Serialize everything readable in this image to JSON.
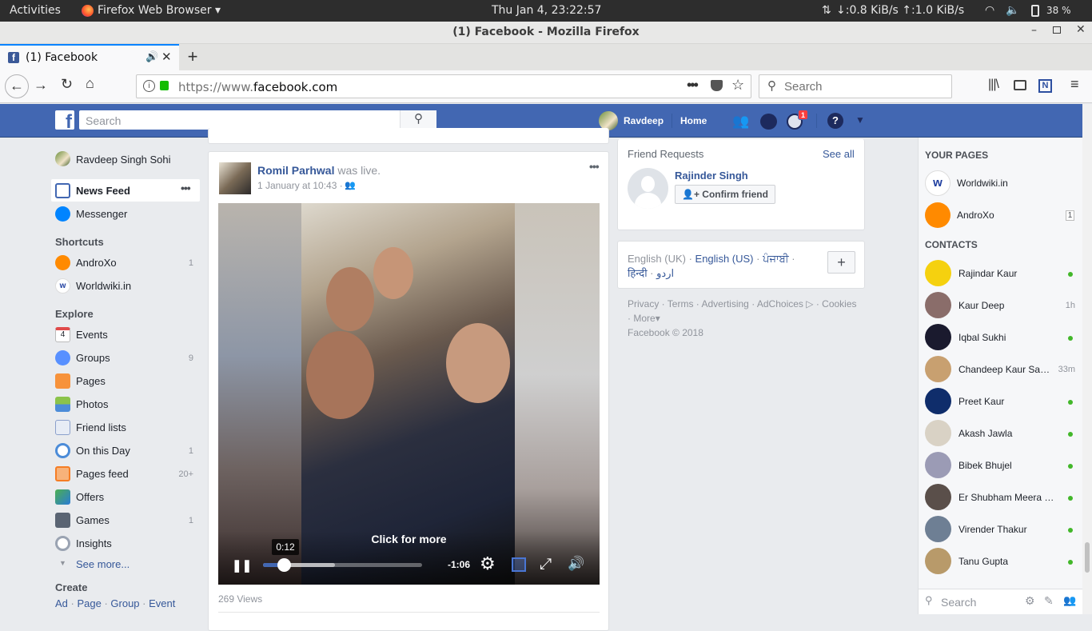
{
  "system": {
    "activities": "Activities",
    "app_name": "Firefox Web Browser",
    "clock": "Thu Jan  4, 23:22:57",
    "network": "↓:0.8 KiB/s ↑:1.0 KiB/s",
    "battery": "38 %"
  },
  "window": {
    "title": "(1) Facebook - Mozilla Firefox"
  },
  "browser": {
    "tab_title": "(1) Facebook",
    "url_prefix": "https://www.",
    "url_domain": "facebook.com",
    "search_placeholder": "Search"
  },
  "fb_header": {
    "search_placeholder": "Search",
    "user_name": "Ravdeep",
    "home_label": "Home",
    "notif_count": "1"
  },
  "left_nav": {
    "profile_name": "Ravdeep Singh Sohi",
    "news_feed": "News Feed",
    "messenger": "Messenger",
    "shortcuts_title": "Shortcuts",
    "shortcuts": [
      {
        "label": "AndroXo",
        "count": "1"
      },
      {
        "label": "Worldwiki.in",
        "count": ""
      }
    ],
    "explore_title": "Explore",
    "explore": [
      {
        "label": "Events",
        "count": ""
      },
      {
        "label": "Groups",
        "count": "9"
      },
      {
        "label": "Pages",
        "count": ""
      },
      {
        "label": "Photos",
        "count": ""
      },
      {
        "label": "Friend lists",
        "count": ""
      },
      {
        "label": "On this Day",
        "count": "1"
      },
      {
        "label": "Pages feed",
        "count": "20+"
      },
      {
        "label": "Offers",
        "count": ""
      },
      {
        "label": "Games",
        "count": "1"
      },
      {
        "label": "Insights",
        "count": ""
      }
    ],
    "see_more": "See more...",
    "create_title": "Create",
    "create_links": [
      "Ad",
      "Page",
      "Group",
      "Event"
    ],
    "events_day": "4"
  },
  "post": {
    "author": "Romil Parhwal",
    "action": "was live.",
    "timestamp": "1 January at 10:43 ·",
    "video": {
      "current_time": "0:12",
      "remaining": "-1:06",
      "overlay_text": "Click for more",
      "progress": 0.13,
      "buffered": 0.45
    },
    "views": "269 Views"
  },
  "friend_requests": {
    "title": "Friend Requests",
    "see_all": "See all",
    "name": "Rajinder Singh",
    "confirm": "Confirm friend"
  },
  "languages": {
    "current": "English (UK)",
    "others": [
      "English (US)",
      "ਪੰਜਾਬੀ",
      "हिन्दी",
      "اردو"
    ]
  },
  "footer": {
    "links": [
      "Privacy",
      "Terms",
      "Advertising",
      "AdChoices",
      "Cookies",
      "More"
    ],
    "copyright": "Facebook © 2018"
  },
  "right_sidebar": {
    "your_pages_title": "YOUR PAGES",
    "pages": [
      {
        "name": "Worldwiki.in",
        "badge": ""
      },
      {
        "name": "AndroXo",
        "badge": "1"
      }
    ],
    "contacts_title": "CONTACTS",
    "contacts": [
      {
        "name": "Rajindar Kaur",
        "status": "",
        "online": true,
        "color": "#f5d10f"
      },
      {
        "name": "Kaur Deep",
        "status": "1h",
        "online": false,
        "color": "#8a6d6a"
      },
      {
        "name": "Iqbal Sukhi",
        "status": "",
        "online": true,
        "color": "#1a1a2e"
      },
      {
        "name": "Chandeep Kaur Sa…",
        "status": "33m",
        "online": false,
        "color": "#c8a070"
      },
      {
        "name": "Preet Kaur",
        "status": "",
        "online": true,
        "color": "#0f2d6b"
      },
      {
        "name": "Akash Jawla",
        "status": "",
        "online": true,
        "color": "#d9d2c5"
      },
      {
        "name": "Bibek Bhujel",
        "status": "",
        "online": true,
        "color": "#9b9bb5"
      },
      {
        "name": "Er Shubham Meera …",
        "status": "",
        "online": true,
        "color": "#5a4f4a"
      },
      {
        "name": "Virender Thakur",
        "status": "",
        "online": true,
        "color": "#6e7f94"
      },
      {
        "name": "Tanu Gupta",
        "status": "",
        "online": true,
        "color": "#b89a6a"
      }
    ],
    "search_placeholder": "Search"
  }
}
